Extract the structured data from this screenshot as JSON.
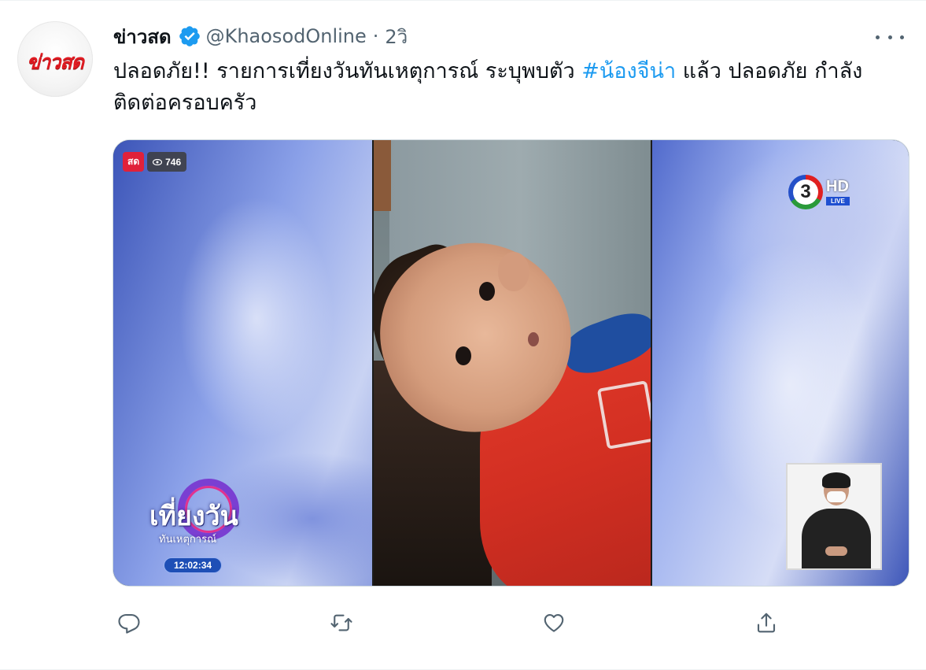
{
  "tweet": {
    "avatar_text": "ข่าวสด",
    "display_name": "ข่าวสด",
    "handle": "@KhaosodOnline",
    "separator": "·",
    "time": "2วิ",
    "text_before": "ปลอดภัย!! รายการเที่ยงวันทันเหตุการณ์ ระบุพบตัว ",
    "hashtag": "#น้องจีน่า",
    "text_after": " แล้ว ปลอดภัย กำลังติดต่อครอบครัว"
  },
  "media": {
    "live_badge": "สด",
    "view_count": "746",
    "channel_number": "3",
    "channel_hd": "HD",
    "channel_live": "LIVE",
    "show_title": "เที่ยงวัน",
    "show_subtitle": "ทันเหตุการณ์",
    "clock": "12:02:34"
  },
  "actions": [
    {
      "name": "reply",
      "icon": "reply-icon"
    },
    {
      "name": "retweet",
      "icon": "retweet-icon"
    },
    {
      "name": "like",
      "icon": "like-icon"
    },
    {
      "name": "share",
      "icon": "share-icon"
    }
  ],
  "colors": {
    "accent": "#1d9bf0",
    "secondary_text": "#536471",
    "primary_text": "#0f1419",
    "live_red": "#e0213a"
  }
}
